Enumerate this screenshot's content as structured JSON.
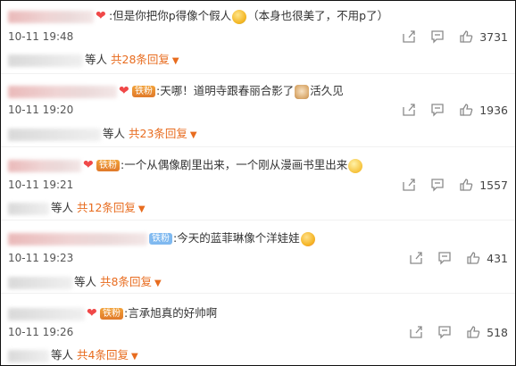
{
  "comments": [
    {
      "comment": "但是你把你p得像个假人",
      "comment_tail": "（本身也很美了，不用p了）",
      "time": "10-11 19:48",
      "likes": "3731",
      "reply_suffix": "等人",
      "reply_count": "共28条回复",
      "emoji_icon": "laughing-tears-emoji-icon"
    },
    {
      "fan_badge": "铁粉",
      "comment": "天哪！道明寺跟春丽合影了",
      "comment_tail": "活久见",
      "time": "10-11 19:20",
      "likes": "1936",
      "reply_suffix": "等人",
      "reply_count": "共23条回复",
      "emoji_icon": "doge-emoji-icon"
    },
    {
      "fan_badge": "铁粉",
      "comment": "一个从偶像剧里出来，一个刚从漫画书里出来",
      "time": "10-11 19:21",
      "likes": "1557",
      "reply_suffix": "等人",
      "reply_count": "共12条回复",
      "emoji_icon": "scream-emoji-icon"
    },
    {
      "fan_badge": "铁粉",
      "comment": "今天的蓝菲琳像个洋娃娃",
      "time": "10-11 19:23",
      "likes": "431",
      "reply_suffix": "等人",
      "reply_count": "共8条回复",
      "emoji_icon": "blowing-kiss-emoji-icon"
    },
    {
      "fan_badge": "铁粉",
      "comment": "言承旭真的好帅啊",
      "time": "10-11 19:26",
      "likes": "518",
      "reply_suffix": "等人",
      "reply_count": "共4条回复"
    }
  ],
  "icons": {
    "share": "share-icon",
    "comment": "comment-icon",
    "like": "thumbs-up-icon",
    "heart_badge": "heart-badge-icon",
    "caret": "caret-down-icon"
  },
  "colors": {
    "accent": "#e86c1f",
    "fan_badge_gold": "#f2a23a",
    "fan_badge_blue": "#7fb9f0",
    "icon_gray": "#8a8a8a"
  }
}
